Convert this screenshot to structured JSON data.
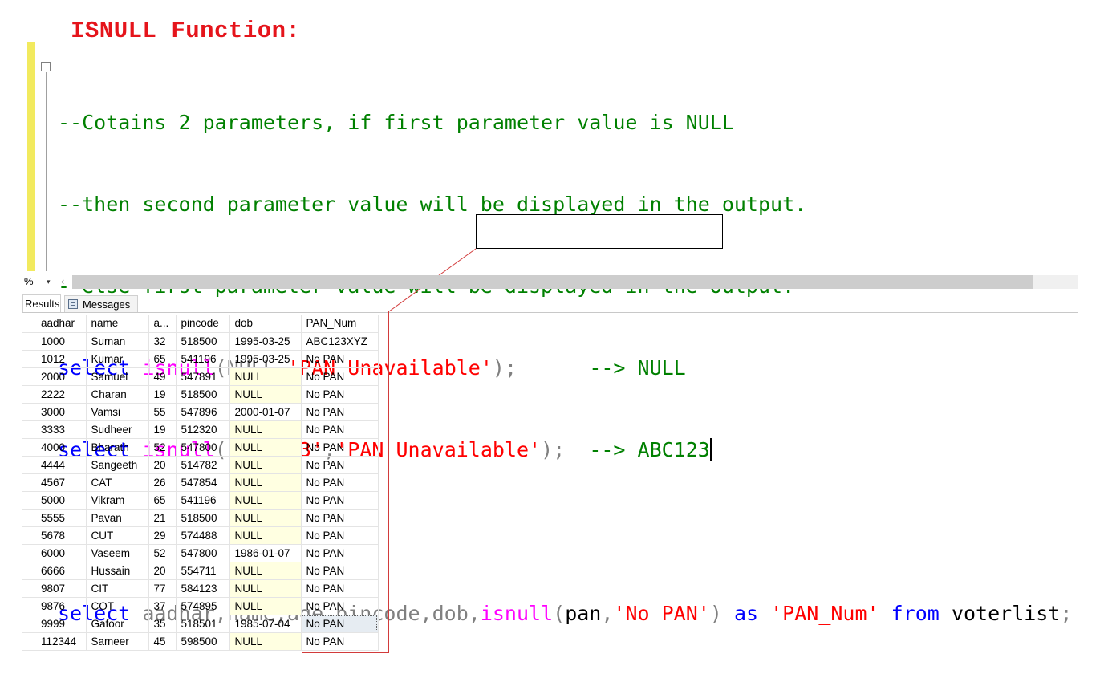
{
  "title": "ISNULL Function:",
  "editor": {
    "comments": [
      "--Cotains 2 parameters, if first parameter value is NULL",
      "--then second parameter value will be displayed in the output.",
      "--else first parameter value will be displayed in the output."
    ],
    "query1": {
      "kw": "select",
      "fn": "isnull",
      "open": "(",
      "arg1": "NULL",
      "comma": ",",
      "arg2": "'PAN Unavailable'",
      "close": ");",
      "pad": "      ",
      "note": "--> NULL"
    },
    "query2": {
      "kw": "select",
      "fn": "isnull",
      "open": "(",
      "arg1": "'ABC123'",
      "comma": ",",
      "arg2": "'PAN Unavailable'",
      "close": ");",
      "pad": "  ",
      "note": "--> ABC123"
    },
    "query3": {
      "kw": "select",
      "cols": "aadhar,name,age,pincode,dob,",
      "fn": "isnull",
      "open": "(",
      "arg1": "pan",
      "comma": ",",
      "arg2": "'No PAN'",
      "close": ")",
      "as": "as",
      "alias": "'PAN_Num'",
      "from": "from",
      "table": "voterlist",
      "semi": ";"
    }
  },
  "zoom": "%",
  "tabs": {
    "results": "Results",
    "messages": "Messages"
  },
  "grid": {
    "columns": [
      "aadhar",
      "name",
      "a...",
      "pincode",
      "dob",
      "PAN_Num"
    ],
    "rows": [
      [
        "1000",
        "Suman",
        "32",
        "518500",
        "1995-03-25",
        "ABC123XYZ"
      ],
      [
        "1012",
        "Kumar",
        "65",
        "541196",
        "1995-03-25",
        "No PAN"
      ],
      [
        "2000",
        "Samuel",
        "49",
        "547891",
        "NULL",
        "No PAN"
      ],
      [
        "2222",
        "Charan",
        "19",
        "518500",
        "NULL",
        "No PAN"
      ],
      [
        "3000",
        "Vamsi",
        "55",
        "547896",
        "2000-01-07",
        "No PAN"
      ],
      [
        "3333",
        "Sudheer",
        "19",
        "512320",
        "NULL",
        "No PAN"
      ],
      [
        "4000",
        "Bharath",
        "52",
        "547800",
        "NULL",
        "No PAN"
      ],
      [
        "4444",
        "Sangeeth",
        "20",
        "514782",
        "NULL",
        "No PAN"
      ],
      [
        "4567",
        "CAT",
        "26",
        "547854",
        "NULL",
        "No PAN"
      ],
      [
        "5000",
        "Vikram",
        "65",
        "541196",
        "NULL",
        "No PAN"
      ],
      [
        "5555",
        "Pavan",
        "21",
        "518500",
        "NULL",
        "No PAN"
      ],
      [
        "5678",
        "CUT",
        "29",
        "574488",
        "NULL",
        "No PAN"
      ],
      [
        "6000",
        "Vaseem",
        "52",
        "547800",
        "1986-01-07",
        "No PAN"
      ],
      [
        "6666",
        "Hussain",
        "20",
        "554711",
        "NULL",
        "No PAN"
      ],
      [
        "9807",
        "CIT",
        "77",
        "584123",
        "NULL",
        "No PAN"
      ],
      [
        "9876",
        "COT",
        "37",
        "574895",
        "NULL",
        "No PAN"
      ],
      [
        "9999",
        "Gafoor",
        "35",
        "518501",
        "1985-07-04",
        "No PAN"
      ],
      [
        "112344",
        "Sameer",
        "45",
        "598500",
        "NULL",
        "No PAN"
      ]
    ],
    "selected_row": 16
  },
  "colors": {
    "title": "#e5141b",
    "comment": "#008000",
    "keyword": "#0000ff",
    "function": "#ff00ff",
    "string": "#ff0000",
    "null_cell": "#ffffe1"
  }
}
